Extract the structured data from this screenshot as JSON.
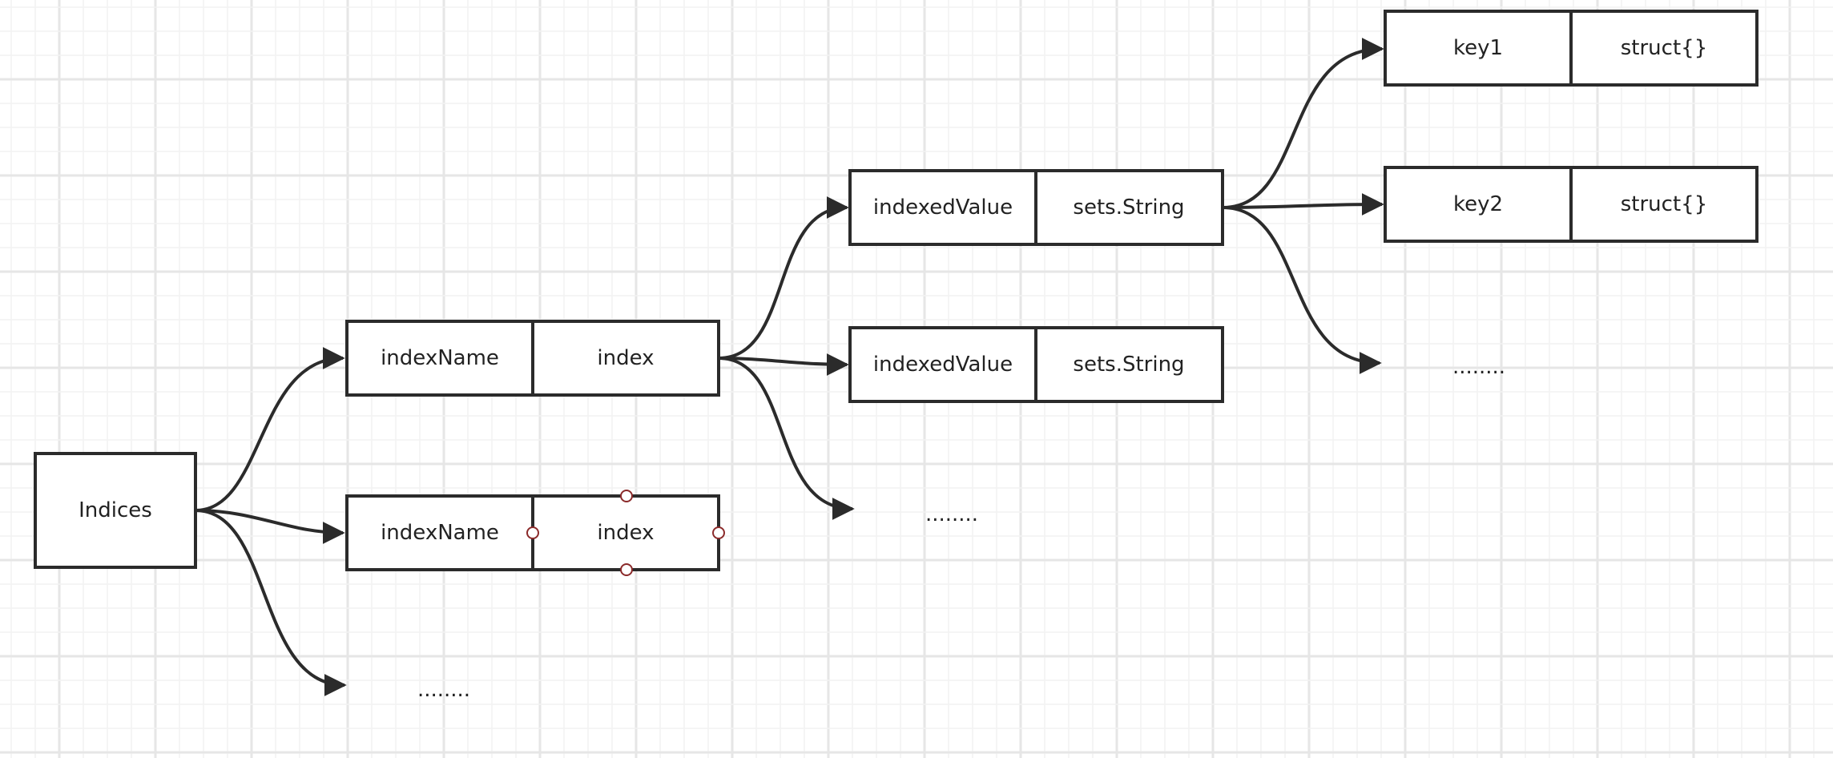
{
  "colors": {
    "stroke": "#2b2b2b",
    "grid_minor": "#f2f2f2",
    "grid_major": "#e6e6e6",
    "handle": "#8b2a2a"
  },
  "nodes": {
    "indices": "Indices",
    "level1": [
      {
        "left": "indexName",
        "right": "index"
      },
      {
        "left": "indexName",
        "right": "index",
        "selected": true
      }
    ],
    "level1_more": "........",
    "level2": [
      {
        "left": "indexedValue",
        "right": "sets.String"
      },
      {
        "left": "indexedValue",
        "right": "sets.String"
      }
    ],
    "level2_more": "........",
    "level3": [
      {
        "left": "key1",
        "right": "struct{}"
      },
      {
        "left": "key2",
        "right": "struct{}"
      }
    ],
    "level3_more": "........"
  }
}
